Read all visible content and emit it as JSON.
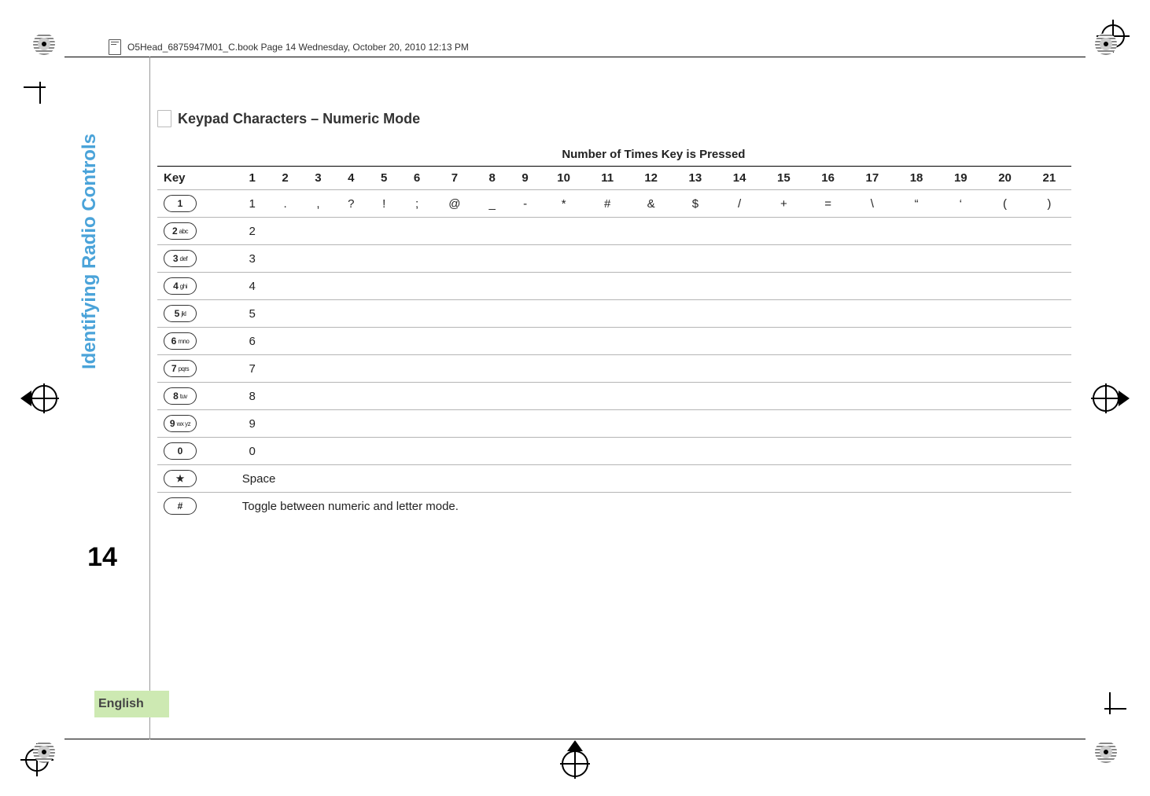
{
  "header": {
    "filename_line": "O5Head_6875947M01_C.book  Page 14  Wednesday, October 20, 2010  12:13 PM"
  },
  "sidebar": {
    "section_label": "Identifying Radio Controls",
    "page_number": "14",
    "language": "English"
  },
  "heading": "Keypad Characters – Numeric Mode",
  "table": {
    "caption": "Number of Times Key is Pressed",
    "key_col": "Key",
    "cols": [
      "1",
      "2",
      "3",
      "4",
      "5",
      "6",
      "7",
      "8",
      "9",
      "10",
      "11",
      "12",
      "13",
      "14",
      "15",
      "16",
      "17",
      "18",
      "19",
      "20",
      "21"
    ],
    "rows": [
      {
        "key_main": "1",
        "key_sub": "",
        "cells": [
          "1",
          ".",
          ",",
          "?",
          "!",
          ";",
          "@",
          "_",
          "-",
          "*",
          "#",
          "&",
          "$",
          "/",
          "+",
          "=",
          "\\",
          "“",
          "‘",
          "(",
          ")"
        ]
      },
      {
        "key_main": "2",
        "key_sub": "abc",
        "cells": [
          "2",
          "",
          "",
          "",
          "",
          "",
          "",
          "",
          "",
          "",
          "",
          "",
          "",
          "",
          "",
          "",
          "",
          "",
          "",
          "",
          ""
        ]
      },
      {
        "key_main": "3",
        "key_sub": "def",
        "cells": [
          "3",
          "",
          "",
          "",
          "",
          "",
          "",
          "",
          "",
          "",
          "",
          "",
          "",
          "",
          "",
          "",
          "",
          "",
          "",
          "",
          ""
        ]
      },
      {
        "key_main": "4",
        "key_sub": "ghi",
        "cells": [
          "4",
          "",
          "",
          "",
          "",
          "",
          "",
          "",
          "",
          "",
          "",
          "",
          "",
          "",
          "",
          "",
          "",
          "",
          "",
          "",
          ""
        ]
      },
      {
        "key_main": "5",
        "key_sub": "jkl",
        "cells": [
          "5",
          "",
          "",
          "",
          "",
          "",
          "",
          "",
          "",
          "",
          "",
          "",
          "",
          "",
          "",
          "",
          "",
          "",
          "",
          "",
          ""
        ]
      },
      {
        "key_main": "6",
        "key_sub": "mno",
        "cells": [
          "6",
          "",
          "",
          "",
          "",
          "",
          "",
          "",
          "",
          "",
          "",
          "",
          "",
          "",
          "",
          "",
          "",
          "",
          "",
          "",
          ""
        ]
      },
      {
        "key_main": "7",
        "key_sub": "pqrs",
        "cells": [
          "7",
          "",
          "",
          "",
          "",
          "",
          "",
          "",
          "",
          "",
          "",
          "",
          "",
          "",
          "",
          "",
          "",
          "",
          "",
          "",
          ""
        ]
      },
      {
        "key_main": "8",
        "key_sub": "tuv",
        "cells": [
          "8",
          "",
          "",
          "",
          "",
          "",
          "",
          "",
          "",
          "",
          "",
          "",
          "",
          "",
          "",
          "",
          "",
          "",
          "",
          "",
          ""
        ]
      },
      {
        "key_main": "9",
        "key_sub": "wx yz",
        "cells": [
          "9",
          "",
          "",
          "",
          "",
          "",
          "",
          "",
          "",
          "",
          "",
          "",
          "",
          "",
          "",
          "",
          "",
          "",
          "",
          "",
          ""
        ]
      },
      {
        "key_main": "0",
        "key_sub": "",
        "cells": [
          "0",
          "",
          "",
          "",
          "",
          "",
          "",
          "",
          "",
          "",
          "",
          "",
          "",
          "",
          "",
          "",
          "",
          "",
          "",
          "",
          ""
        ]
      },
      {
        "key_main": "★",
        "key_sub": "",
        "full": "Space"
      },
      {
        "key_main": "#",
        "key_sub": "",
        "full": "Toggle between numeric and letter mode."
      }
    ]
  }
}
